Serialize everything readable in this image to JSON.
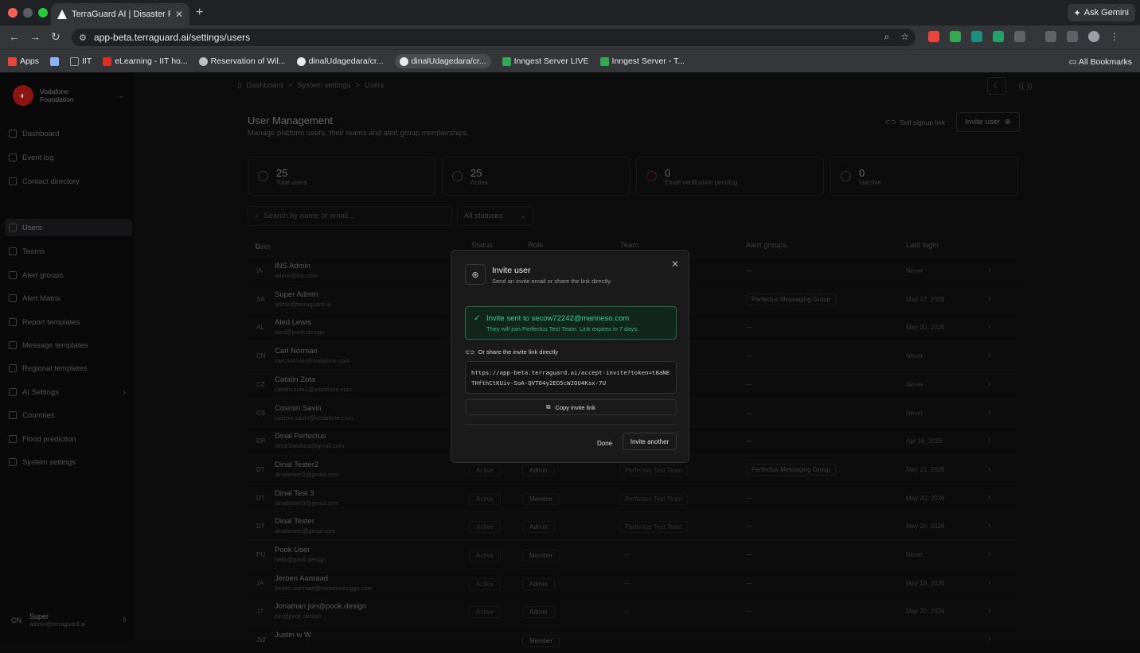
{
  "browser": {
    "tab_title": "TerraGuard AI | Disaster Risk I",
    "url": "app-beta.terraguard.ai/settings/users",
    "ask_gemini": "Ask Gemini",
    "bookmarks": [
      {
        "label": "Apps",
        "color": "#e8453c"
      },
      {
        "label": "",
        "color": "#8ab4f8"
      },
      {
        "label": "IIT",
        "color": "#9aa0a6"
      },
      {
        "label": "eLearning - IIT ho...",
        "color": "#d93025"
      },
      {
        "label": "Reservation of Wil...",
        "color": "#bdc1c6"
      },
      {
        "label": "dinalUdagedara/cr...",
        "color": "#e8eaed"
      },
      {
        "label": "dinalUdagedara/cr...",
        "color": "#e8eaed"
      },
      {
        "label": "Inngest Server LIVE",
        "color": "#34a853"
      },
      {
        "label": "Inngest Server - T...",
        "color": "#34a853"
      }
    ],
    "all_bookmarks": "All Bookmarks"
  },
  "org": {
    "name_line1": "Vodafone",
    "name_line2": "Foundation"
  },
  "sidebar": {
    "items": [
      {
        "label": "Dashboard"
      },
      {
        "label": "Event log"
      },
      {
        "label": "Contact directory"
      },
      {
        "label": "Users"
      },
      {
        "label": "Teams"
      },
      {
        "label": "Alert groups"
      },
      {
        "label": "Alert Matrix"
      },
      {
        "label": "Report templates"
      },
      {
        "label": "Message templates"
      },
      {
        "label": "Regional templates"
      },
      {
        "label": "AI Settings"
      },
      {
        "label": "Countries"
      },
      {
        "label": "Flood prediction"
      },
      {
        "label": "System settings"
      }
    ],
    "user": {
      "initials": "CN",
      "name": "Super",
      "email": "admin@terraguard.ai"
    }
  },
  "breadcrumb": {
    "a": "Dashboard",
    "b": "System settings",
    "c": "Users",
    "sep": ">"
  },
  "page": {
    "title": "User Management",
    "subtitle": "Manage platform users, their teams and alert group memberships.",
    "self_signup": "Self signup link",
    "invite_user": "Invite user"
  },
  "stats": [
    {
      "value": "25",
      "label": "Total users"
    },
    {
      "value": "25",
      "label": "Active"
    },
    {
      "value": "0",
      "label": "Email verification pending"
    },
    {
      "value": "0",
      "label": "Inactive"
    }
  ],
  "search": {
    "placeholder": "Search by name or email..."
  },
  "status_filter": "All statuses",
  "table": {
    "headers": {
      "user": "User",
      "status": "Status",
      "role": "Role",
      "team": "Team",
      "alert_groups": "Alert groups",
      "last_login": "Last login"
    },
    "rows": [
      {
        "ini": "IA",
        "name": "INS Admin",
        "email": "admin@ins.com",
        "status": "",
        "role": "",
        "team": "",
        "alert": "—",
        "login": "Never"
      },
      {
        "ini": "SA",
        "name": "Super Admin",
        "email": "admin@terraguard.ai",
        "status": "",
        "role": "",
        "team": "",
        "alert": "Perfectus Messaging Group",
        "login": "May 27, 2026"
      },
      {
        "ini": "AL",
        "name": "Aled Lewis",
        "email": "aled@pook.design",
        "status": "",
        "role": "",
        "team": "",
        "alert": "—",
        "login": "May 20, 2026"
      },
      {
        "ini": "CN",
        "name": "Carl Norman",
        "email": "carl.norman@vodafone.com",
        "status": "",
        "role": "",
        "team": "",
        "alert": "—",
        "login": "Never"
      },
      {
        "ini": "CZ",
        "name": "Catalin Zota",
        "email": "catalin.zota1@vodafone.com",
        "status": "",
        "role": "",
        "team": "",
        "alert": "—",
        "login": "Never"
      },
      {
        "ini": "CS",
        "name": "Cosmin Savin",
        "email": "cosmin.savin@vodafone.com",
        "status": "",
        "role": "",
        "team": "",
        "alert": "—",
        "login": "Never"
      },
      {
        "ini": "DP",
        "name": "Dinal Perfectus",
        "email": "dinal.bandara@gmail.com",
        "status": "",
        "role": "",
        "team": "",
        "alert": "—",
        "login": "Apr 16, 2026"
      },
      {
        "ini": "DT",
        "name": "Dinal Tester2",
        "email": "dinaltester2@gmail.com",
        "status": "Active",
        "role": "Admin",
        "team": "Perfectus Test Team",
        "alert": "Perfectus Messaging Group",
        "login": "May 21, 2026"
      },
      {
        "ini": "DT",
        "name": "Dinal Test 3",
        "email": "dinaltester3@gmail.com",
        "status": "Active",
        "role": "Member",
        "team": "Perfectus Test Team",
        "alert": "—",
        "login": "May 20, 2026"
      },
      {
        "ini": "DT",
        "name": "Dinal Tester",
        "email": "dinaltester@gmail.com",
        "status": "Active",
        "role": "Admin",
        "team": "Perfectus Test Team",
        "alert": "—",
        "login": "May 20, 2026"
      },
      {
        "ini": "PU",
        "name": "Pook User",
        "email": "hello@pook.design",
        "status": "Active",
        "role": "Member",
        "team": "—",
        "alert": "—",
        "login": "Never"
      },
      {
        "ini": "JA",
        "name": "Jeroen Aanraad",
        "email": "jeroen.aanraad@vodafoneziggo.com",
        "status": "Active",
        "role": "Admin",
        "team": "—",
        "alert": "—",
        "login": "May 18, 2026"
      },
      {
        "ini": "JJ",
        "name": "Jonathan jon@pook.design",
        "email": "jon@pook.design",
        "status": "Active",
        "role": "Admin",
        "team": "—",
        "alert": "—",
        "login": "May 20, 2026"
      },
      {
        "ini": "JW",
        "name": "Justin w W",
        "email": "",
        "status": "",
        "role": "Member",
        "team": "",
        "alert": "",
        "login": ""
      }
    ]
  },
  "modal": {
    "title": "Invite user",
    "subtitle": "Send an invite email or share the link directly.",
    "success_title": "Invite sent to secow72242@marineso.com",
    "success_sub": "They will join Perfectus Test Team. Link expires in 7 days.",
    "share_label": "Or share the invite link directly",
    "link": "https://app-beta.terraguard.ai/accept-invite?token=t8aNETHfthCtKUiv-SoA-QVTO4y2EO5cWJOU4Ksx-7U",
    "copy": "Copy invite link",
    "done": "Done",
    "another": "Invite another"
  }
}
